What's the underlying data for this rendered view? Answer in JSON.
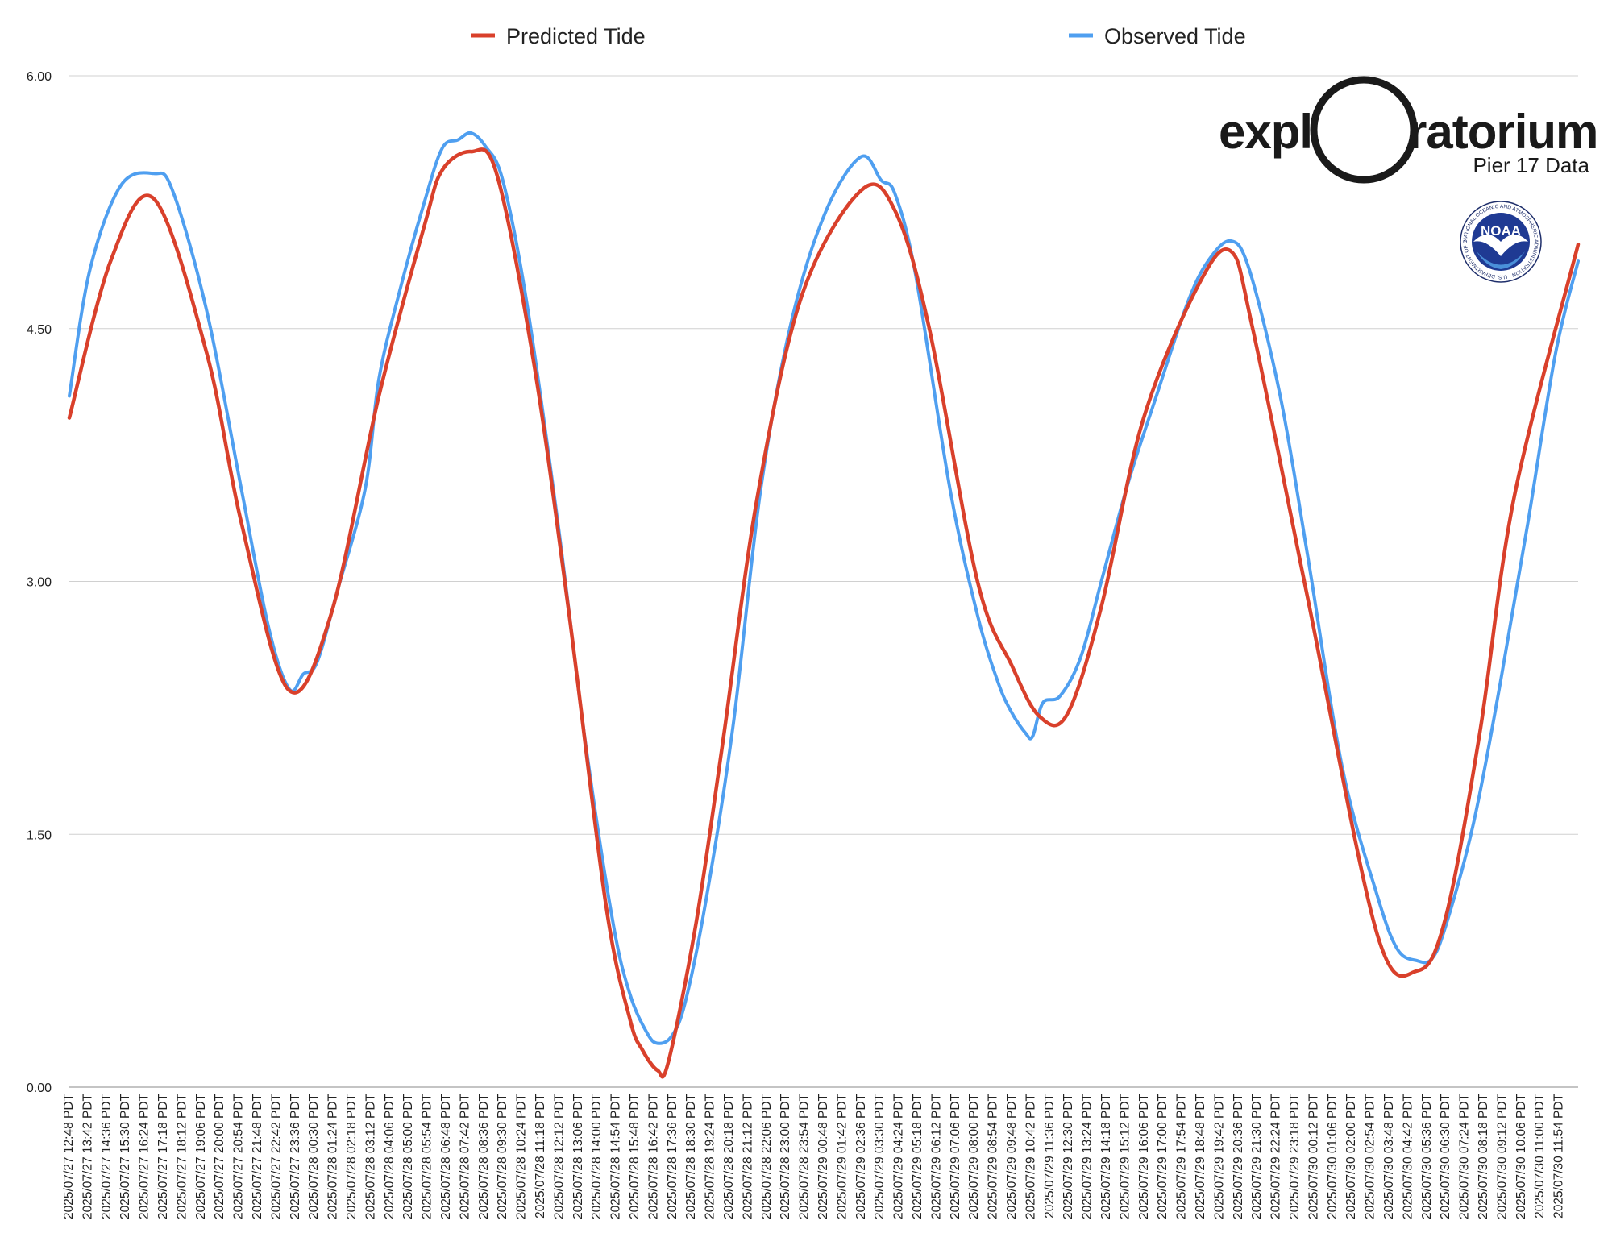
{
  "legend": {
    "predicted_label": "Predicted Tide",
    "observed_label": "Observed Tide"
  },
  "logo": {
    "word_left": "expl",
    "word_right": "ratorium",
    "subtitle": "Pier 17 Data",
    "noaa": "NOAA",
    "noaa_ring": "NATIONAL OCEANIC AND ATMOSPHERIC ADMINISTRATION · U.S. DEPARTMENT OF COMMERCE"
  },
  "colors": {
    "predicted": "#d9402b",
    "observed": "#4f9ff0",
    "grid": "#d0d0d0",
    "noaa_blue": "#1f3a93"
  },
  "chart_data": {
    "type": "line",
    "ylim": [
      0,
      6
    ],
    "yticks": [
      "0.00",
      "1.50",
      "3.00",
      "4.50",
      "6.00"
    ],
    "x_range_minutes": [
      0,
      4386
    ],
    "x_tick_labels": [
      "2025/07/27 12:48 PDT",
      "2025/07/27 13:42 PDT",
      "2025/07/27 14:36 PDT",
      "2025/07/27 15:30 PDT",
      "2025/07/27 16:24 PDT",
      "2025/07/27 17:18 PDT",
      "2025/07/27 18:12 PDT",
      "2025/07/27 19:06 PDT",
      "2025/07/27 20:00 PDT",
      "2025/07/27 20:54 PDT",
      "2025/07/27 21:48 PDT",
      "2025/07/27 22:42 PDT",
      "2025/07/27 23:36 PDT",
      "2025/07/28 00:30 PDT",
      "2025/07/28 01:24 PDT",
      "2025/07/28 02:18 PDT",
      "2025/07/28 03:12 PDT",
      "2025/07/28 04:06 PDT",
      "2025/07/28 05:00 PDT",
      "2025/07/28 05:54 PDT",
      "2025/07/28 06:48 PDT",
      "2025/07/28 07:42 PDT",
      "2025/07/28 08:36 PDT",
      "2025/07/28 09:30 PDT",
      "2025/07/28 10:24 PDT",
      "2025/07/28 11:18 PDT",
      "2025/07/28 12:12 PDT",
      "2025/07/28 13:06 PDT",
      "2025/07/28 14:00 PDT",
      "2025/07/28 14:54 PDT",
      "2025/07/28 15:48 PDT",
      "2025/07/28 16:42 PDT",
      "2025/07/28 17:36 PDT",
      "2025/07/28 18:30 PDT",
      "2025/07/28 19:24 PDT",
      "2025/07/28 20:18 PDT",
      "2025/07/28 21:12 PDT",
      "2025/07/28 22:06 PDT",
      "2025/07/28 23:00 PDT",
      "2025/07/28 23:54 PDT",
      "2025/07/29 00:48 PDT",
      "2025/07/29 01:42 PDT",
      "2025/07/29 02:36 PDT",
      "2025/07/29 03:30 PDT",
      "2025/07/29 04:24 PDT",
      "2025/07/29 05:18 PDT",
      "2025/07/29 06:12 PDT",
      "2025/07/29 07:06 PDT",
      "2025/07/29 08:00 PDT",
      "2025/07/29 08:54 PDT",
      "2025/07/29 09:48 PDT",
      "2025/07/29 10:42 PDT",
      "2025/07/29 11:36 PDT",
      "2025/07/29 12:30 PDT",
      "2025/07/29 13:24 PDT",
      "2025/07/29 14:18 PDT",
      "2025/07/29 15:12 PDT",
      "2025/07/29 16:06 PDT",
      "2025/07/29 17:00 PDT",
      "2025/07/29 17:54 PDT",
      "2025/07/29 18:48 PDT",
      "2025/07/29 19:42 PDT",
      "2025/07/29 20:36 PDT",
      "2025/07/29 21:30 PDT",
      "2025/07/29 22:24 PDT",
      "2025/07/29 23:18 PDT",
      "2025/07/30 00:12 PDT",
      "2025/07/30 01:06 PDT",
      "2025/07/30 02:00 PDT",
      "2025/07/30 02:54 PDT",
      "2025/07/30 03:48 PDT",
      "2025/07/30 04:42 PDT",
      "2025/07/30 05:36 PDT",
      "2025/07/30 06:30 PDT",
      "2025/07/30 07:24 PDT",
      "2025/07/30 08:18 PDT",
      "2025/07/30 09:12 PDT",
      "2025/07/30 10:06 PDT",
      "2025/07/30 11:00 PDT",
      "2025/07/30 11:54 PDT"
    ],
    "grid": true,
    "legend_position": "top",
    "series": [
      {
        "name": "Predicted Tide",
        "color": "#d9402b",
        "points": [
          [
            0,
            3.97
          ],
          [
            120,
            4.9
          ],
          [
            246,
            5.27
          ],
          [
            400,
            4.35
          ],
          [
            500,
            3.35
          ],
          [
            636,
            2.36
          ],
          [
            760,
            2.8
          ],
          [
            900,
            4.1
          ],
          [
            1032,
            5.11
          ],
          [
            1084,
            5.44
          ],
          [
            1168,
            5.55
          ],
          [
            1242,
            5.42
          ],
          [
            1350,
            4.3
          ],
          [
            1450,
            2.85
          ],
          [
            1560,
            1.08
          ],
          [
            1630,
            0.4
          ],
          [
            1666,
            0.22
          ],
          [
            1710,
            0.1
          ],
          [
            1740,
            0.14
          ],
          [
            1820,
            0.95
          ],
          [
            1900,
            2.05
          ],
          [
            2000,
            3.5
          ],
          [
            2130,
            4.7
          ],
          [
            2302,
            5.32
          ],
          [
            2400,
            5.2
          ],
          [
            2500,
            4.5
          ],
          [
            2640,
            3.0
          ],
          [
            2740,
            2.5
          ],
          [
            2820,
            2.2
          ],
          [
            2900,
            2.21
          ],
          [
            3000,
            2.85
          ],
          [
            3120,
            3.95
          ],
          [
            3280,
            4.75
          ],
          [
            3376,
            4.96
          ],
          [
            3440,
            4.5
          ],
          [
            3600,
            2.9
          ],
          [
            3800,
            0.92
          ],
          [
            3918,
            0.69
          ],
          [
            4000,
            1.0
          ],
          [
            4100,
            2.1
          ],
          [
            4200,
            3.5
          ],
          [
            4386,
            5.0
          ]
        ]
      },
      {
        "name": "Observed Tide",
        "color": "#4f9ff0",
        "points": [
          [
            0,
            4.1
          ],
          [
            60,
            4.85
          ],
          [
            150,
            5.35
          ],
          [
            246,
            5.42
          ],
          [
            300,
            5.32
          ],
          [
            400,
            4.6
          ],
          [
            500,
            3.55
          ],
          [
            580,
            2.72
          ],
          [
            640,
            2.36
          ],
          [
            680,
            2.45
          ],
          [
            720,
            2.52
          ],
          [
            780,
            2.95
          ],
          [
            860,
            3.55
          ],
          [
            900,
            4.2
          ],
          [
            960,
            4.72
          ],
          [
            1032,
            5.25
          ],
          [
            1084,
            5.57
          ],
          [
            1130,
            5.62
          ],
          [
            1168,
            5.66
          ],
          [
            1210,
            5.58
          ],
          [
            1260,
            5.38
          ],
          [
            1330,
            4.65
          ],
          [
            1420,
            3.35
          ],
          [
            1500,
            2.05
          ],
          [
            1580,
            0.98
          ],
          [
            1630,
            0.55
          ],
          [
            1680,
            0.32
          ],
          [
            1710,
            0.26
          ],
          [
            1750,
            0.3
          ],
          [
            1790,
            0.5
          ],
          [
            1850,
            1.1
          ],
          [
            1930,
            2.15
          ],
          [
            2010,
            3.55
          ],
          [
            2100,
            4.55
          ],
          [
            2200,
            5.2
          ],
          [
            2302,
            5.52
          ],
          [
            2360,
            5.38
          ],
          [
            2400,
            5.3
          ],
          [
            2460,
            4.82
          ],
          [
            2560,
            3.55
          ],
          [
            2640,
            2.8
          ],
          [
            2700,
            2.4
          ],
          [
            2740,
            2.22
          ],
          [
            2780,
            2.1
          ],
          [
            2800,
            2.08
          ],
          [
            2830,
            2.28
          ],
          [
            2880,
            2.32
          ],
          [
            2940,
            2.55
          ],
          [
            3000,
            3.0
          ],
          [
            3080,
            3.6
          ],
          [
            3160,
            4.1
          ],
          [
            3250,
            4.65
          ],
          [
            3310,
            4.9
          ],
          [
            3376,
            5.02
          ],
          [
            3430,
            4.85
          ],
          [
            3520,
            4.1
          ],
          [
            3600,
            3.15
          ],
          [
            3700,
            1.9
          ],
          [
            3800,
            1.15
          ],
          [
            3860,
            0.82
          ],
          [
            3918,
            0.75
          ],
          [
            3960,
            0.76
          ],
          [
            4000,
            0.95
          ],
          [
            4080,
            1.55
          ],
          [
            4160,
            2.4
          ],
          [
            4240,
            3.35
          ],
          [
            4320,
            4.35
          ],
          [
            4386,
            4.9
          ]
        ]
      }
    ]
  }
}
